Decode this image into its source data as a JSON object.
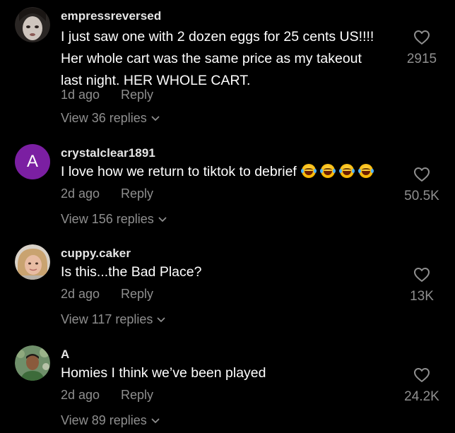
{
  "comments": [
    {
      "username": "empressreversed",
      "text_lines": [
        "I just saw one with 2 dozen eggs for 25 cents US!!!!",
        "Her whole cart was the same price as my takeout",
        "last night. HER WHOLE CART."
      ],
      "date": "1d ago",
      "reply_label": "Reply",
      "view_replies": "View 36 replies",
      "likes": "2915"
    },
    {
      "username": "crystalclear1891",
      "avatar_letter": "A",
      "avatar_color": "#7b1fa2",
      "text": "I love how we return to tiktok to debrief",
      "emoji": [
        "😂",
        "😂",
        "😂",
        "😂"
      ],
      "date": "2d ago",
      "reply_label": "Reply",
      "view_replies": "View 156 replies",
      "likes": "50.5K"
    },
    {
      "username": "cuppy.caker",
      "text": "Is this...the Bad Place?",
      "date": "2d ago",
      "reply_label": "Reply",
      "view_replies": "View 117 replies",
      "likes": "13K"
    },
    {
      "username": "A",
      "text": "Homies I think we’ve been played",
      "date": "2d ago",
      "reply_label": "Reply",
      "view_replies": "View 89 replies",
      "likes": "24.2K"
    }
  ],
  "icons": {
    "like": "heart-outline-icon",
    "expand": "chevron-down-icon"
  },
  "colors": {
    "background": "#000000",
    "muted_text": "#8f8f8f"
  }
}
